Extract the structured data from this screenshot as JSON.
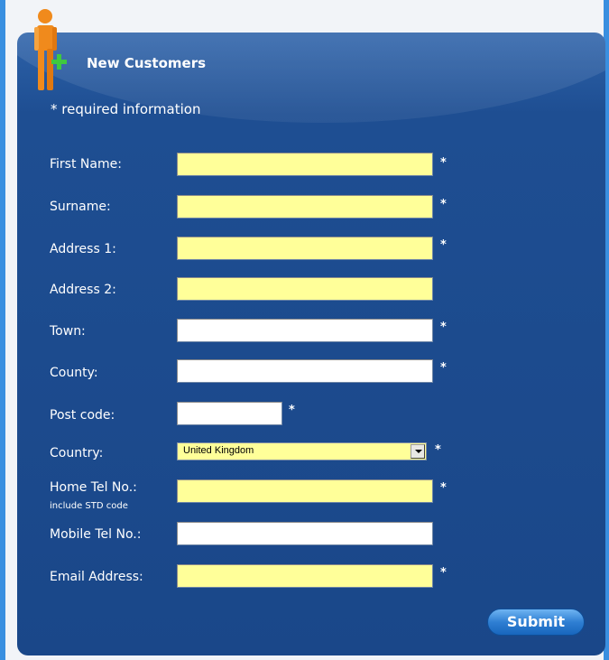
{
  "header": {
    "title": "New Customers",
    "required_note": "* required information",
    "icon": "add-person-icon"
  },
  "required_marker": "*",
  "fields": {
    "first_name": {
      "label": "First Name:",
      "value": "",
      "required": true,
      "background": "#ffff99"
    },
    "surname": {
      "label": "Surname:",
      "value": "",
      "required": true,
      "background": "#ffff99"
    },
    "address1": {
      "label": "Address 1:",
      "value": "",
      "required": true,
      "background": "#ffff99"
    },
    "address2": {
      "label": "Address 2:",
      "value": "",
      "required": false,
      "background": "#ffff99"
    },
    "town": {
      "label": "Town:",
      "value": "",
      "required": true,
      "background": "#ffffff"
    },
    "county": {
      "label": "County:",
      "value": "",
      "required": true,
      "background": "#ffffff"
    },
    "postcode": {
      "label": "Post code:",
      "value": "",
      "required": true,
      "background": "#ffffff"
    },
    "country": {
      "label": "Country:",
      "selected": "United Kingdom",
      "required": true,
      "background": "#ffff99"
    },
    "home_tel": {
      "label": "Home Tel No.:",
      "sublabel": "include STD code",
      "value": "",
      "required": true,
      "background": "#ffff99"
    },
    "mobile_tel": {
      "label": "Mobile Tel No.:",
      "value": "",
      "required": false,
      "background": "#ffffff"
    },
    "email": {
      "label": "Email Address:",
      "value": "",
      "required": true,
      "background": "#ffff99"
    }
  },
  "submit_label": "Submit",
  "colors": {
    "page_background": "#3a8fe0",
    "panel": "#1e4e92",
    "required_field": "#ffff99",
    "button": "#2f7fd3"
  }
}
